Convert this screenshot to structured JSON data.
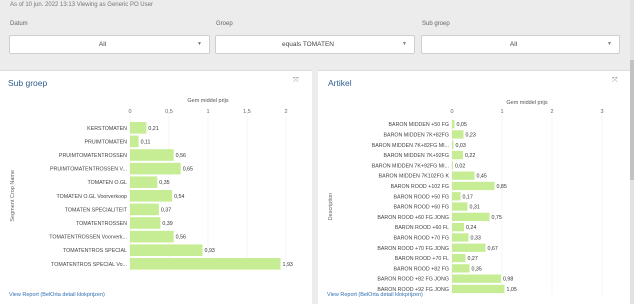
{
  "header": {
    "as_of": "As of 10 jun. 2022 13:13 Viewing as Generic PO User"
  },
  "filters": [
    {
      "label": "Datum",
      "value": "All"
    },
    {
      "label": "Groep",
      "value": "equals TOMATEN"
    },
    {
      "label": "Sub groep",
      "value": "All"
    }
  ],
  "panels": {
    "sub_groep": {
      "title": "Sub groep",
      "footer_link": "View Report (BelOrta detail klokprijzen)",
      "expand_icon": "expand-icon"
    },
    "artikel": {
      "title": "Artikel",
      "footer_link": "View Report (BelOrta detail klokprijzen)",
      "expand_icon": "expand-icon"
    }
  },
  "chart_data": [
    {
      "type": "bar",
      "orientation": "horizontal",
      "xlabel": "Gem middel prijs",
      "ylabel": "Segment Crop Name",
      "xlim": [
        0,
        2
      ],
      "xticks": [
        "0",
        "0,5",
        "1",
        "1,5",
        "2"
      ],
      "bar_color": "#c6ec94",
      "categories": [
        "KERSTOMATEN",
        "PRUIMTOMATEN",
        "PRUIMTOMATENTROSSEN",
        "PRUIMTOMATENTROSSEN V...",
        "TOMATEN O.GL",
        "TOMATEN O.GL Voorverkoop",
        "TOMATEN SPECIALITEIT",
        "TOMATENTROSSEN",
        "TOMATENTROSSEN Voorverk...",
        "TOMATENTROS SPECIAL",
        "TOMATENTROS SPECIAL Vo..."
      ],
      "values": [
        0.21,
        0.11,
        0.56,
        0.65,
        0.35,
        0.54,
        0.37,
        0.39,
        0.56,
        0.93,
        1.93
      ],
      "value_labels": [
        "0,21",
        "0,11",
        "0,56",
        "0,65",
        "0,35",
        "0,54",
        "0,37",
        "0,39",
        "0,56",
        "0,93",
        "1,93"
      ]
    },
    {
      "type": "bar",
      "orientation": "horizontal",
      "xlabel": "Gem middel prijs",
      "ylabel": "Description",
      "xlim": [
        0,
        3
      ],
      "xticks": [
        "0",
        "1",
        "2",
        "3"
      ],
      "bar_color": "#c6ec94",
      "categories": [
        "BARON MIDDEN +50 FG",
        "BARON MIDDEN 7K+82FG",
        "BARON MIDDEN 7K+82FG MI...",
        "BARON MIDDEN 7K+92FG",
        "BARON MIDDEN 7K+92FG MI...",
        "BARON MIDDEN 7K102FG K",
        "BARON ROOD +102 FG",
        "BARON ROOD +50 FG",
        "BARON ROOD +60 FG",
        "BARON ROOD +60 FG JONG",
        "BARON ROOD +60 FL",
        "BARON ROOD +70 FG",
        "BARON ROOD +70 FG JONG",
        "BARON ROOD +70 FL",
        "BARON ROOD +82 FG",
        "BARON ROOD +82 FG JONG",
        "BARON ROOD +92 FG JONG"
      ],
      "values": [
        0.05,
        0.23,
        0.03,
        0.22,
        0.02,
        0.45,
        0.85,
        0.17,
        0.31,
        0.75,
        0.24,
        0.33,
        0.67,
        0.27,
        0.35,
        0.98,
        1.05
      ],
      "value_labels": [
        "0,05",
        "0,23",
        "0,03",
        "0,22",
        "0,02",
        "0,45",
        "0,85",
        "0,17",
        "0,31",
        "0,75",
        "0,24",
        "0,33",
        "0,67",
        "0,27",
        "0,35",
        "0,98",
        "1,05"
      ]
    }
  ]
}
